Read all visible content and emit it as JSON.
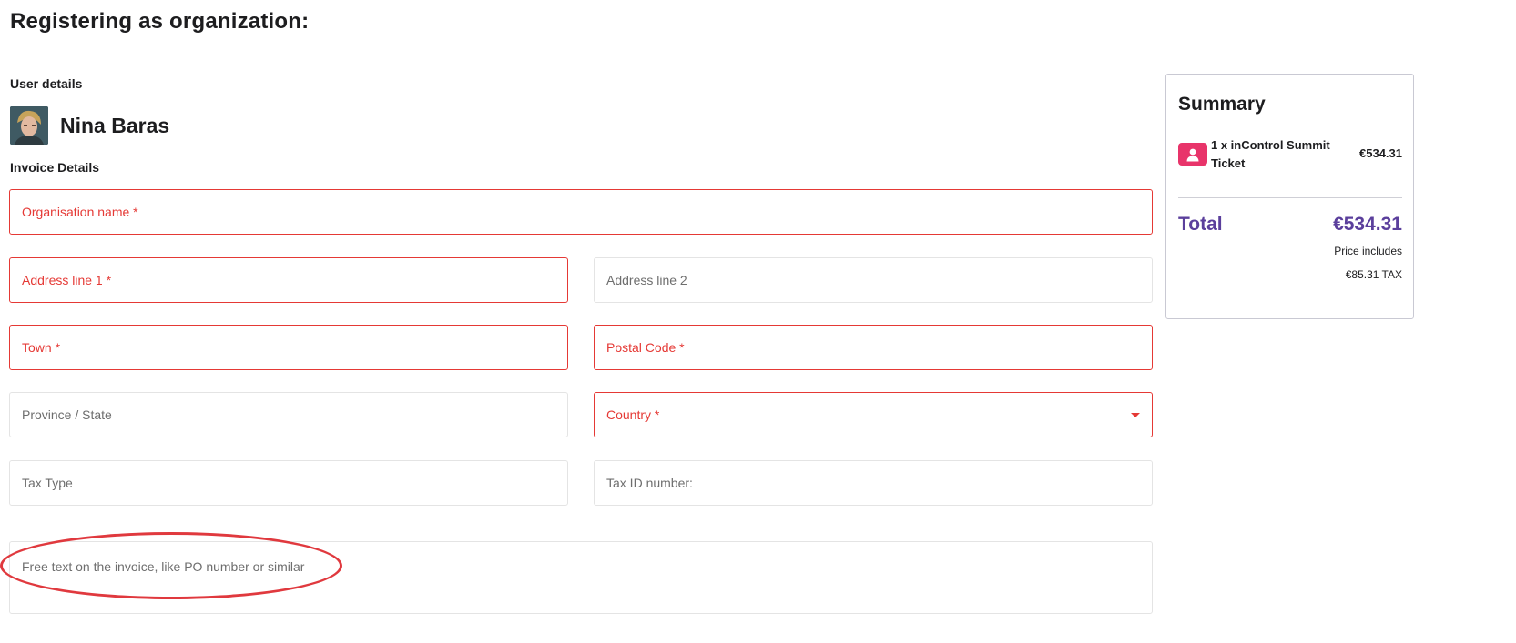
{
  "page": {
    "title": "Registering as organization:"
  },
  "user_details": {
    "label": "User details",
    "name": "Nina Baras"
  },
  "invoice": {
    "label": "Invoice Details",
    "fields": {
      "organisation_name": "Organisation name *",
      "address_line_1": "Address line 1 *",
      "address_line_2": "Address line 2",
      "town": "Town *",
      "postal_code": "Postal Code *",
      "province_state": "Province / State",
      "country": "Country *",
      "tax_type": "Tax Type",
      "tax_id": "Tax ID number:",
      "free_text": "Free text on the invoice, like PO number or similar"
    }
  },
  "summary": {
    "title": "Summary",
    "item": {
      "icon": "person-icon",
      "label": "1 x inControl Summit Ticket",
      "price": "€534.31"
    },
    "total_label": "Total",
    "total_value": "€534.31",
    "tax_note_line1": "Price includes",
    "tax_note_line2": "€85.31 TAX"
  },
  "colors": {
    "required_red": "#e53935",
    "accent_purple": "#5b3f9c",
    "ticket_pink": "#e8346a",
    "annotation_red": "#e0393e"
  }
}
